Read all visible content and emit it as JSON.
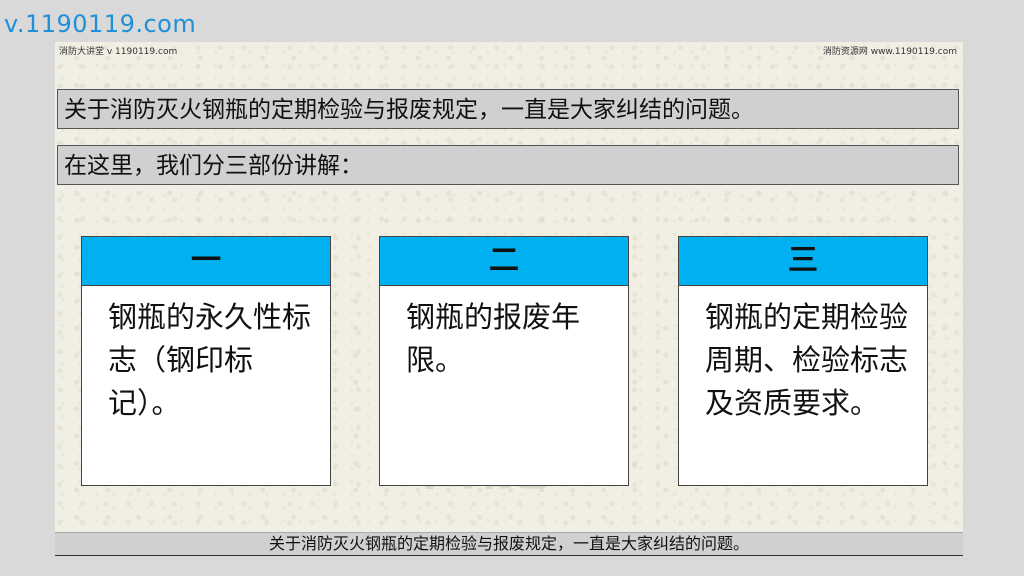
{
  "watermark": {
    "url": "v.1190119.com"
  },
  "slide": {
    "header_left": "消防大讲堂 v 1190119.com",
    "header_right": "消防资源网  www.1190119.com",
    "bar1": "关于消防灭火钢瓶的定期检验与报废规定，一直是大家纠结的问题。",
    "bar2": "在这里，我们分三部份讲解：",
    "background_mark": "磐龍",
    "cards": [
      {
        "header": "一",
        "body": "钢瓶的永久性标志（钢印标记）。"
      },
      {
        "header": "二",
        "body": "钢瓶的报废年限。"
      },
      {
        "header": "三",
        "body": "钢瓶的定期检验周期、检验标志及资质要求。"
      }
    ]
  },
  "subtitle": "关于消防灭火钢瓶的定期检验与报废规定，一直是大家纠结的问题。",
  "colors": {
    "card_header": "#00b0f0",
    "text_bar": "#d0d0d0",
    "url_watermark": "#1e90d8"
  }
}
